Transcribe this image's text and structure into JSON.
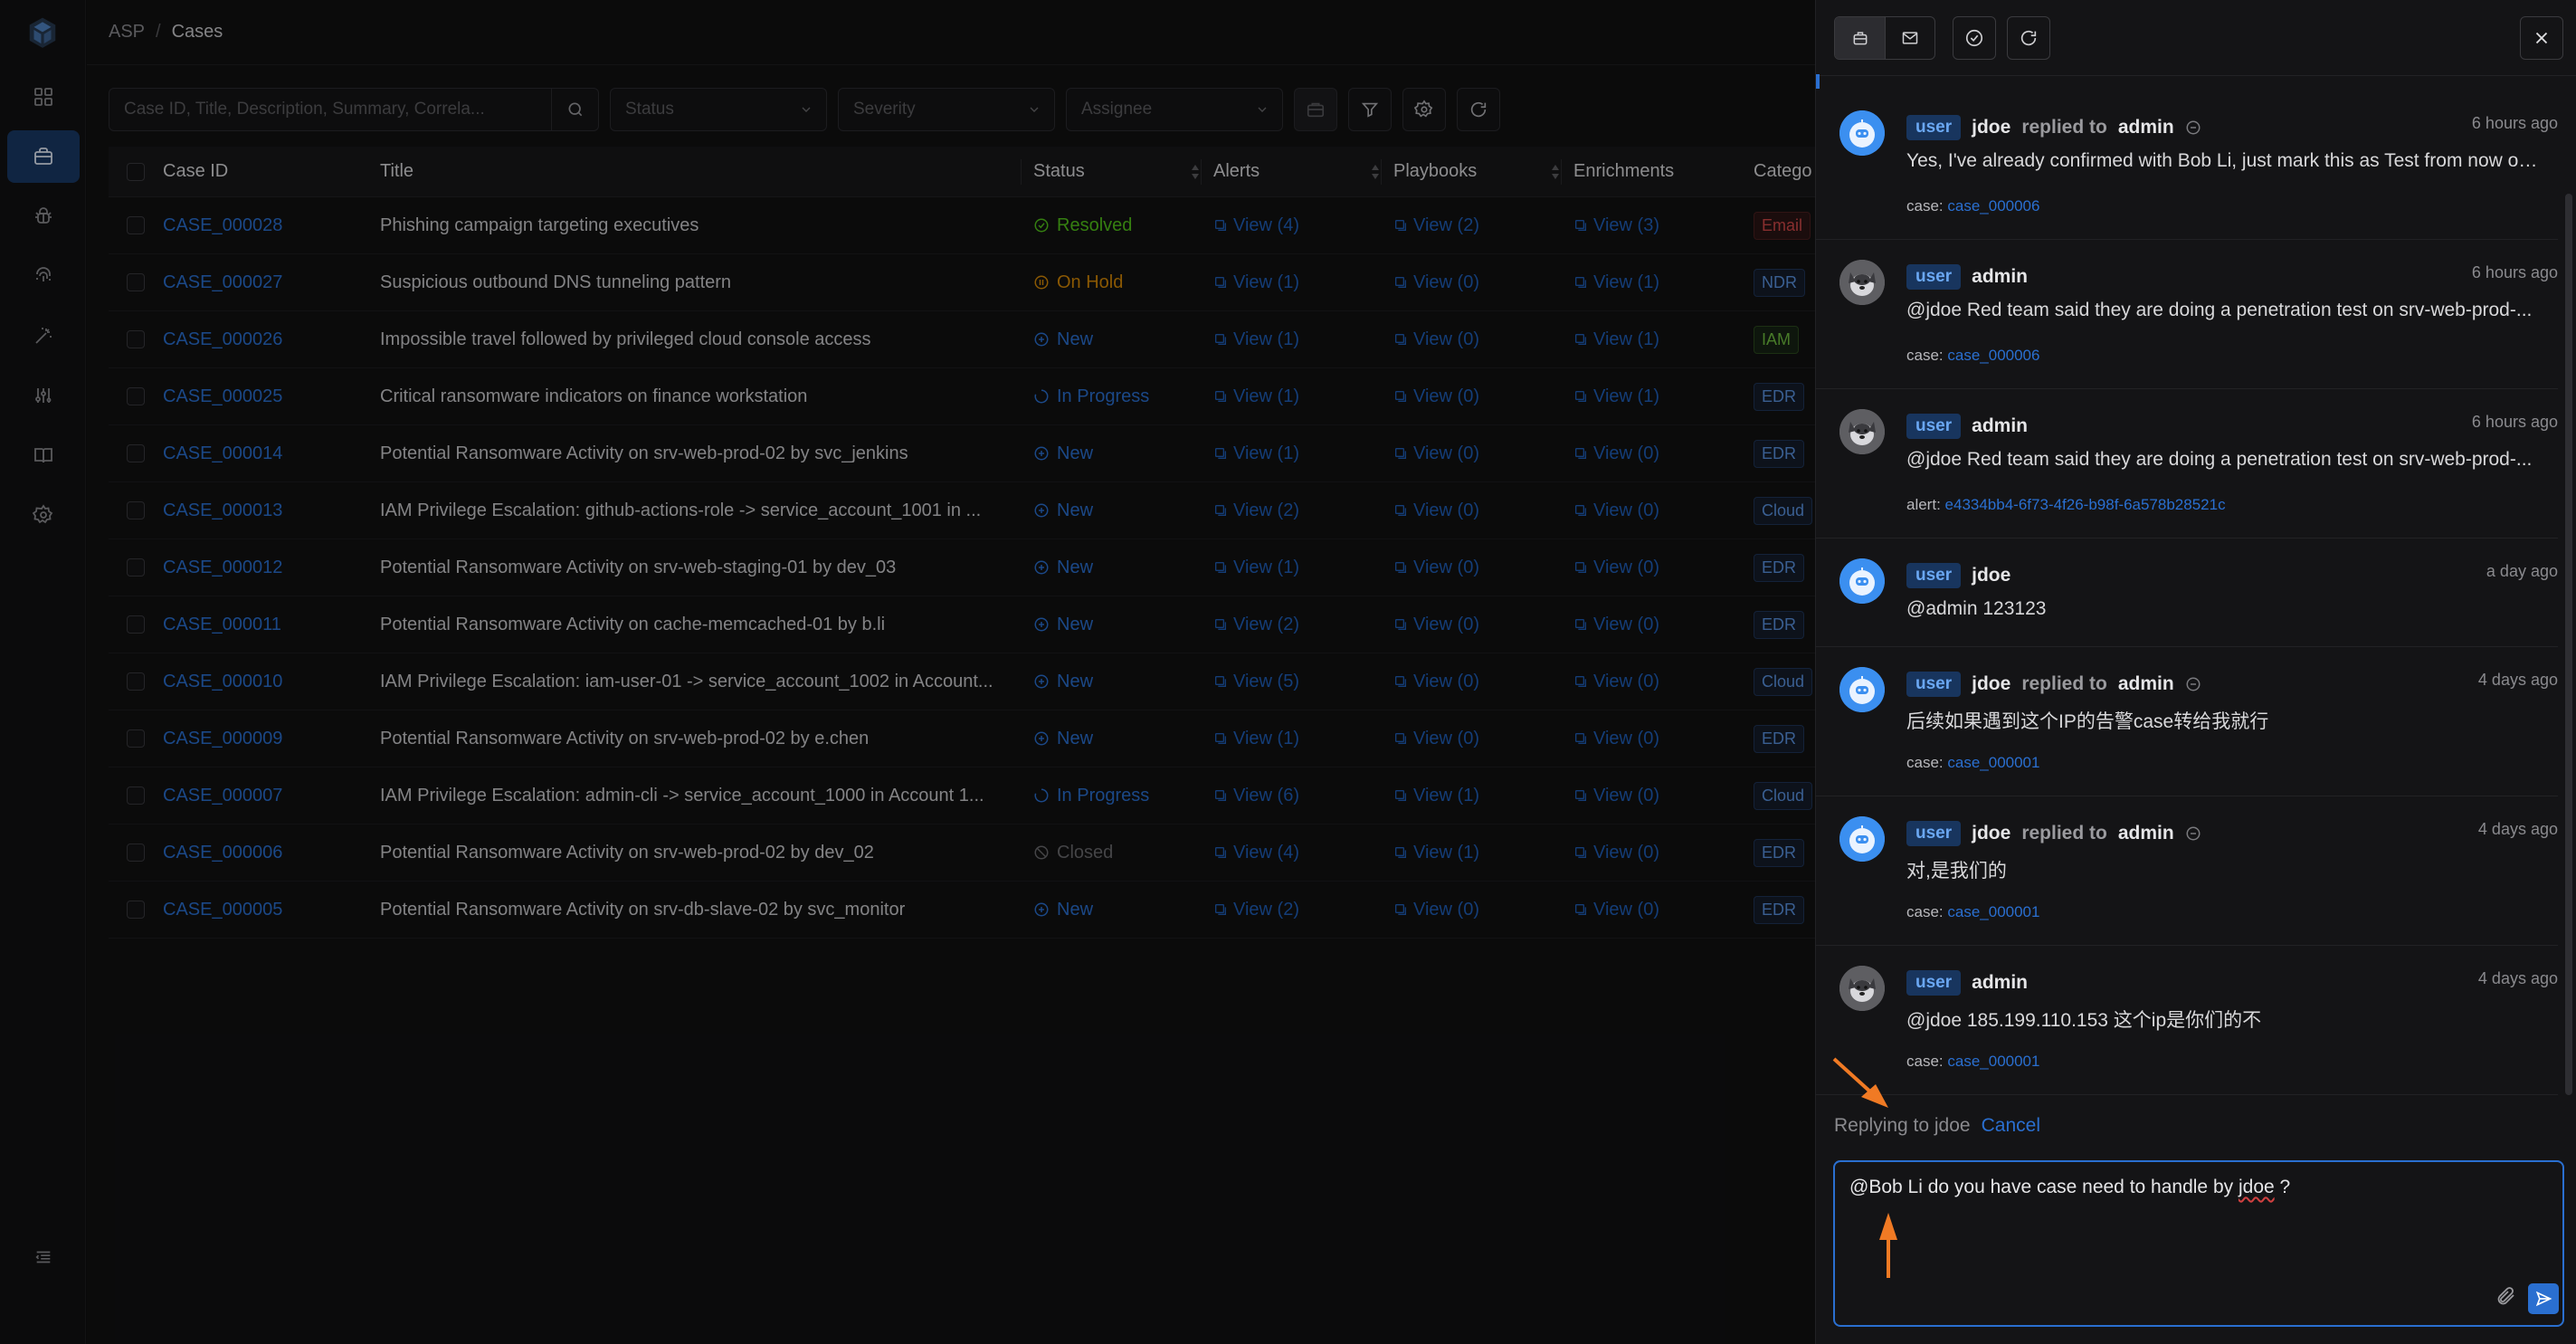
{
  "breadcrumb": {
    "root": "ASP",
    "separator": "/",
    "current": "Cases"
  },
  "filters": {
    "search_placeholder": "Case ID, Title, Description, Summary, Correla...",
    "status_placeholder": "Status",
    "severity_placeholder": "Severity",
    "assignee_placeholder": "Assignee"
  },
  "table": {
    "headers": {
      "case_id": "Case ID",
      "title": "Title",
      "status": "Status",
      "alerts": "Alerts",
      "playbooks": "Playbooks",
      "enrichments": "Enrichments",
      "category": "Catego"
    },
    "rows": [
      {
        "id": "CASE_000028",
        "title": "Phishing campaign targeting executives",
        "status": "Resolved",
        "status_kind": "resolved",
        "alerts": "View (4)",
        "playbooks": "View (2)",
        "enrichments": "View (3)",
        "category": "Email"
      },
      {
        "id": "CASE_000027",
        "title": "Suspicious outbound DNS tunneling pattern",
        "status": "On Hold",
        "status_kind": "hold",
        "alerts": "View (1)",
        "playbooks": "View (0)",
        "enrichments": "View (1)",
        "category": "NDR"
      },
      {
        "id": "CASE_000026",
        "title": "Impossible travel followed by privileged cloud console access",
        "status": "New",
        "status_kind": "new",
        "alerts": "View (1)",
        "playbooks": "View (0)",
        "enrichments": "View (1)",
        "category": "IAM"
      },
      {
        "id": "CASE_000025",
        "title": "Critical ransomware indicators on finance workstation",
        "status": "In Progress",
        "status_kind": "progress",
        "alerts": "View (1)",
        "playbooks": "View (0)",
        "enrichments": "View (1)",
        "category": "EDR"
      },
      {
        "id": "CASE_000014",
        "title": "Potential Ransomware Activity on srv-web-prod-02 by svc_jenkins",
        "status": "New",
        "status_kind": "new",
        "alerts": "View (1)",
        "playbooks": "View (0)",
        "enrichments": "View (0)",
        "category": "EDR"
      },
      {
        "id": "CASE_000013",
        "title": "IAM Privilege Escalation: github-actions-role -> service_account_1001 in ...",
        "status": "New",
        "status_kind": "new",
        "alerts": "View (2)",
        "playbooks": "View (0)",
        "enrichments": "View (0)",
        "category": "Cloud"
      },
      {
        "id": "CASE_000012",
        "title": "Potential Ransomware Activity on srv-web-staging-01 by dev_03",
        "status": "New",
        "status_kind": "new",
        "alerts": "View (1)",
        "playbooks": "View (0)",
        "enrichments": "View (0)",
        "category": "EDR"
      },
      {
        "id": "CASE_000011",
        "title": "Potential Ransomware Activity on cache-memcached-01 by b.li",
        "status": "New",
        "status_kind": "new",
        "alerts": "View (2)",
        "playbooks": "View (0)",
        "enrichments": "View (0)",
        "category": "EDR"
      },
      {
        "id": "CASE_000010",
        "title": "IAM Privilege Escalation: iam-user-01 -> service_account_1002 in Account...",
        "status": "New",
        "status_kind": "new",
        "alerts": "View (5)",
        "playbooks": "View (0)",
        "enrichments": "View (0)",
        "category": "Cloud"
      },
      {
        "id": "CASE_000009",
        "title": "Potential Ransomware Activity on srv-web-prod-02 by e.chen",
        "status": "New",
        "status_kind": "new",
        "alerts": "View (1)",
        "playbooks": "View (0)",
        "enrichments": "View (0)",
        "category": "EDR"
      },
      {
        "id": "CASE_000007",
        "title": "IAM Privilege Escalation: admin-cli -> service_account_1000 in Account 1...",
        "status": "In Progress",
        "status_kind": "progress",
        "alerts": "View (6)",
        "playbooks": "View (1)",
        "enrichments": "View (0)",
        "category": "Cloud"
      },
      {
        "id": "CASE_000006",
        "title": "Potential Ransomware Activity on srv-web-prod-02 by dev_02",
        "status": "Closed",
        "status_kind": "closed",
        "alerts": "View (4)",
        "playbooks": "View (1)",
        "enrichments": "View (0)",
        "category": "EDR"
      },
      {
        "id": "CASE_000005",
        "title": "Potential Ransomware Activity on srv-db-slave-02 by svc_monitor",
        "status": "New",
        "status_kind": "new",
        "alerts": "View (2)",
        "playbooks": "View (0)",
        "enrichments": "View (0)",
        "category": "EDR"
      }
    ]
  },
  "messages": [
    {
      "role": "user",
      "user": "jdoe",
      "replied": "replied to",
      "reply_to": "admin",
      "time": "6 hours ago",
      "text": "Yes, I've already confirmed with Bob Li, just mark this as Test from now on...",
      "ref_label": "case:",
      "ref_value": "case_000006",
      "avatar": "bot"
    },
    {
      "role": "user",
      "user": "admin",
      "time": "6 hours ago",
      "text": "@jdoe Red team said they are doing a penetration test on srv-web-prod-...",
      "ref_label": "case:",
      "ref_value": "case_000006",
      "avatar": "dog"
    },
    {
      "role": "user",
      "user": "admin",
      "time": "6 hours ago",
      "text": "@jdoe Red team said they are doing a penetration test on srv-web-prod-...",
      "ref_label": "alert:",
      "ref_value": "e4334bb4-6f73-4f26-b98f-6a578b28521c",
      "avatar": "dog"
    },
    {
      "role": "user",
      "user": "jdoe",
      "time": "a day ago",
      "text": "@admin 123123",
      "avatar": "bot"
    },
    {
      "role": "user",
      "user": "jdoe",
      "replied": "replied to",
      "reply_to": "admin",
      "time": "4 days ago",
      "text": "后续如果遇到这个IP的告警case转给我就行",
      "ref_label": "case:",
      "ref_value": "case_000001",
      "avatar": "bot"
    },
    {
      "role": "user",
      "user": "jdoe",
      "replied": "replied to",
      "reply_to": "admin",
      "time": "4 days ago",
      "text": "对,是我们的",
      "ref_label": "case:",
      "ref_value": "case_000001",
      "avatar": "bot"
    },
    {
      "role": "user",
      "user": "admin",
      "time": "4 days ago",
      "text": "@jdoe 185.199.110.153 这个ip是你们的不",
      "ref_label": "case:",
      "ref_value": "case_000001",
      "avatar": "dog"
    }
  ],
  "composer": {
    "replying_to": "Replying to jdoe",
    "cancel": "Cancel",
    "text_before": "@Bob Li  do you have case need to handle by ",
    "text_misspelled": "jdoe",
    "text_after": " ?"
  },
  "colors": {
    "accent": "#2a6fd0",
    "resolved": "#52c41a",
    "on_hold": "#d48806",
    "new": "#2a6fd0",
    "closed": "#6a6a6e",
    "annotation_arrow": "#f07a24"
  }
}
